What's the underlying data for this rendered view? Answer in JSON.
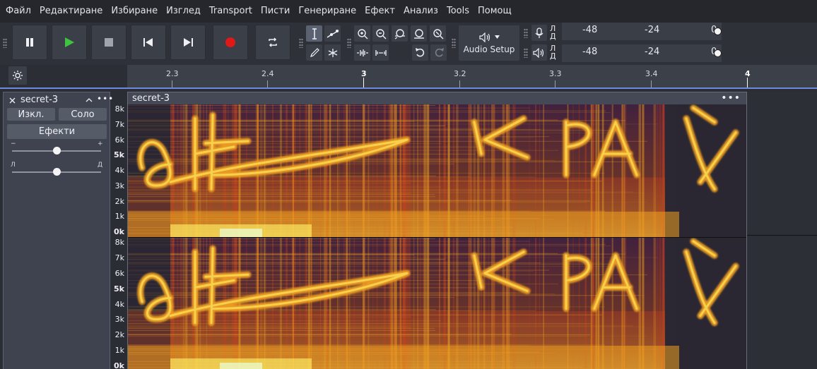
{
  "menu": [
    "Файл",
    "Редактиране",
    "Избиране",
    "Изглед",
    "Transport",
    "Писти",
    "Генериране",
    "Ефект",
    "Анализ",
    "Tools",
    "Помощ"
  ],
  "toolbar": {
    "audio_setup_label": "Audio Setup",
    "icons": {
      "pause": "pause-icon",
      "play": "play-icon",
      "stop": "stop-icon",
      "skip_start": "skip-to-start-icon",
      "skip_end": "skip-to-end-icon",
      "record": "record-icon",
      "loop": "loop-icon",
      "select": "selection-tool-icon",
      "envelope": "envelope-tool-icon",
      "draw": "draw-tool-icon",
      "multi": "multi-tool-icon",
      "zoom_in": "zoom-in-icon",
      "zoom_out": "zoom-out-icon",
      "fit_selection": "fit-selection-icon",
      "fit_project": "fit-project-icon",
      "zoom_toggle": "zoom-toggle-icon",
      "trim": "trim-icon",
      "silence": "silence-icon",
      "undo": "undo-icon",
      "redo": "redo-icon"
    },
    "colors": {
      "play": "#3ec43e",
      "record": "#e01818",
      "stop": "#a0a4ad"
    }
  },
  "meters": {
    "record": {
      "left": "Л",
      "right": "Д",
      "scale": [
        "-48",
        "-24",
        "0"
      ]
    },
    "playback": {
      "left": "Л",
      "right": "Д",
      "scale": [
        "-48",
        "-24",
        "0"
      ]
    }
  },
  "ruler": {
    "ticks": [
      {
        "label": "2.3",
        "major": false
      },
      {
        "label": "2.4",
        "major": false
      },
      {
        "label": "3",
        "major": true
      },
      {
        "label": "3.2",
        "major": false
      },
      {
        "label": "3.3",
        "major": false
      },
      {
        "label": "3.4",
        "major": false
      },
      {
        "label": "4",
        "major": true
      }
    ]
  },
  "track": {
    "name": "secret-3",
    "mute_label": "Изкл.",
    "solo_label": "Соло",
    "effects_label": "Ефекти",
    "gain_minus": "−",
    "gain_plus": "+",
    "pan_left": "Л",
    "pan_right": "Д",
    "gain_level": 0.5,
    "pan_level": 0.5
  },
  "clip": {
    "name": "secret-3",
    "menu": "•••"
  },
  "freq_scale": {
    "channel1": [
      "8k",
      "7k",
      "6k",
      "5k",
      "4k",
      "3k",
      "2k",
      "1k",
      "0k"
    ],
    "channel2": [
      "8k",
      "7k",
      "6k",
      "5k",
      "4k",
      "3k",
      "2k",
      "1k",
      "0k"
    ],
    "bold": [
      "5k",
      "0k"
    ]
  },
  "spectrogram": {
    "hidden_text": "КРАЙ",
    "colors": {
      "bg": "#2b2733",
      "low": "#5a1a4a",
      "mid": "#c2411f",
      "high": "#f0a020",
      "peak": "#fff56a"
    }
  }
}
